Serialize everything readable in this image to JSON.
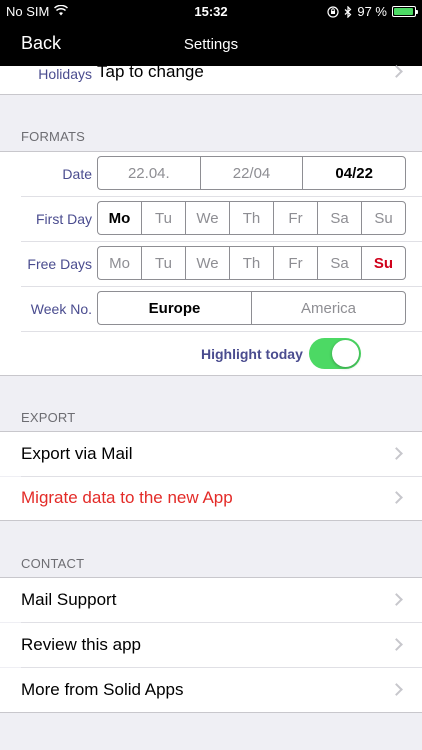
{
  "status": {
    "carrier": "No SIM",
    "time": "15:32",
    "battery": "97 %",
    "battery_fill": 0.97
  },
  "nav": {
    "back_label": "Back",
    "title": "Settings"
  },
  "holidays": {
    "label": "Holidays",
    "value": "Tap to change"
  },
  "formats": {
    "header": "FORMATS",
    "date": {
      "label": "Date",
      "options": [
        "22.04.",
        "22/04",
        "04/22"
      ],
      "selected": 2
    },
    "first_day": {
      "label": "First Day",
      "options": [
        "Mo",
        "Tu",
        "We",
        "Th",
        "Fr",
        "Sa",
        "Su"
      ],
      "selected": 0
    },
    "free_days": {
      "label": "Free Days",
      "options": [
        "Mo",
        "Tu",
        "We",
        "Th",
        "Fr",
        "Sa",
        "Su"
      ],
      "selected": [
        6
      ]
    },
    "week_no": {
      "label": "Week No.",
      "options": [
        "Europe",
        "America"
      ],
      "selected": 0
    },
    "highlight_today": {
      "label": "Highlight today",
      "on": true
    }
  },
  "export": {
    "header": "EXPORT",
    "items": [
      "Export via Mail",
      "Migrate data to the new App"
    ]
  },
  "contact": {
    "header": "CONTACT",
    "items": [
      "Mail Support",
      "Review this app",
      "More from Solid Apps"
    ]
  },
  "colors": {
    "accent_green": "#4cd964",
    "label_blue": "#4a4c8f",
    "warning_red": "#e32b28"
  }
}
